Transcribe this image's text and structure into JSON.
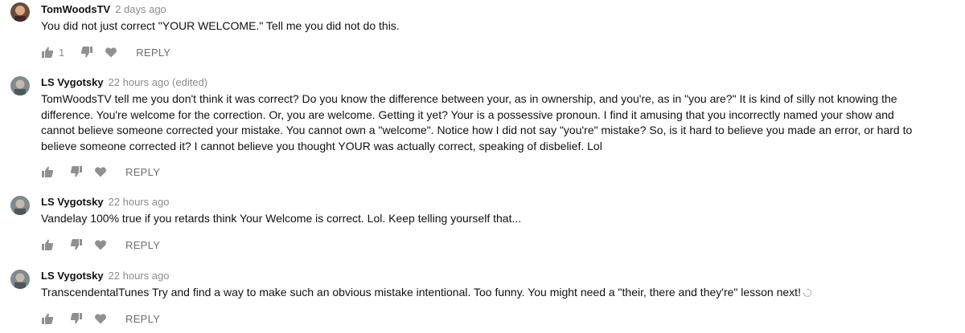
{
  "comments": [
    {
      "author": "TomWoodsTV",
      "meta": "2 days ago",
      "text": "You did not just correct \"YOUR WELCOME.\" Tell me you did not do this.",
      "likes": "1",
      "reply_label": "REPLY",
      "avatar_icon": "user-avatar-photo"
    },
    {
      "author": "LS Vygotsky",
      "meta": "22 hours ago (edited)",
      "text": "TomWoodsTV tell me you don't think it was correct? Do you know the difference between your, as in ownership, and you're, as in \"you are?\" It is kind of silly not knowing the difference. You're welcome for the correction. Or, you are welcome. Getting it yet? Your is a possessive pronoun. I find it amusing that you incorrectly named your show and cannot believe someone corrected your mistake. You cannot own a \"welcome\". Notice how I did not say \"you're\" mistake? So, is it hard to believe you made an error, or hard to believe someone corrected it? I cannot believe you thought YOUR was actually correct, speaking of disbelief. Lol",
      "likes": "",
      "reply_label": "REPLY",
      "avatar_icon": "user-avatar-photo"
    },
    {
      "author": "LS Vygotsky",
      "meta": "22 hours ago",
      "text": "Vandelay 100% true if you retards think Your Welcome is correct. Lol. Keep telling yourself that...",
      "likes": "",
      "reply_label": "REPLY",
      "avatar_icon": "user-avatar-photo"
    },
    {
      "author": "LS Vygotsky",
      "meta": "22 hours ago",
      "text": "TranscendentalTunes Try and find a way to make such an obvious mistake intentional. Too funny. You might need a \"their, there and they're\" lesson next!",
      "likes": "",
      "reply_label": "REPLY",
      "avatar_icon": "user-avatar-photo"
    }
  ],
  "icons": {
    "like": "thumbs-up-icon",
    "dislike": "thumbs-down-icon",
    "heart": "heart-icon",
    "loading": "loading-spinner-icon"
  },
  "colors": {
    "icon_gray": "#909090",
    "meta_gray": "#8c8c8c",
    "text": "#111111"
  }
}
